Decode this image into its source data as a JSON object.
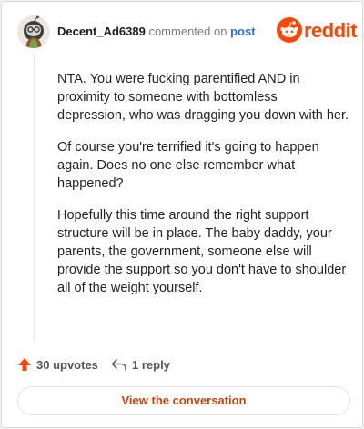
{
  "header": {
    "username": "Decent_Ad6389",
    "commented_on": "commented on",
    "post_link": "post",
    "brand": "reddit"
  },
  "comment": {
    "paragraphs": [
      "NTA. You were fucking parentified AND in proximity to someone with bottomless depression, who was dragging you down with her.",
      "Of course you're terrified it's going to happen again. Does no one else remember what happened?",
      "Hopefully this time around the right support structure will be in place. The baby daddy, your parents, the government, someone else will provide the support so you don't have to shoulder all of the weight yourself."
    ]
  },
  "actions": {
    "upvotes_label": "30 upvotes",
    "replies_label": "1 reply"
  },
  "footer": {
    "view_button": "View the conversation"
  },
  "colors": {
    "brand": "#ff4500",
    "link": "#2a6fdb",
    "button_text": "#c9430c"
  },
  "icons": {
    "avatar": "avatar",
    "logo": "reddit-snoo-icon",
    "upvote": "upvote-arrow-icon",
    "reply": "reply-arrow-icon"
  }
}
